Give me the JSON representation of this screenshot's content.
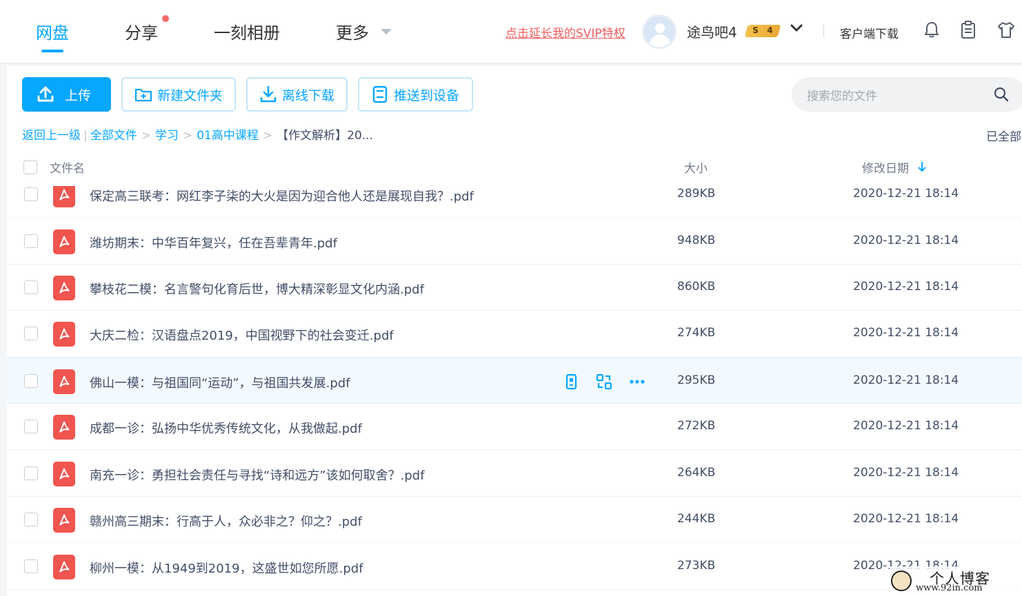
{
  "nav": {
    "tabs": [
      {
        "label": "网盘"
      },
      {
        "label": "分享"
      },
      {
        "label": "一刻相册"
      },
      {
        "label": "更多"
      }
    ],
    "svip_link": "点击延长我的SVIP特权",
    "username": "途鸟吧4",
    "vip_badge": {
      "s": "S",
      "level": "4"
    },
    "client_download": "客户端下载"
  },
  "toolbar": {
    "upload": "上传",
    "new_folder": "新建文件夹",
    "offline_download": "离线下载",
    "push_device": "推送到设备",
    "search_placeholder": "搜索您的文件"
  },
  "breadcrumb": {
    "back": "返回上一级",
    "all_files": "全部文件",
    "level1": "学习",
    "level2": "01高中课程",
    "current": "【作文解析】20...",
    "loaded_all": "已全部"
  },
  "table": {
    "col_name": "文件名",
    "col_size": "大小",
    "col_date": "修改日期",
    "rows": [
      {
        "name": "保定高三联考：网红李子柒的大火是因为迎合他人还是展现自我？.pdf",
        "size": "289KB",
        "date": "2020-12-21 18:14"
      },
      {
        "name": "潍坊期末：中华百年复兴，任在吾辈青年.pdf",
        "size": "948KB",
        "date": "2020-12-21 18:14"
      },
      {
        "name": "攀枝花二模：名言警句化育后世，博大精深彰显文化内涵.pdf",
        "size": "860KB",
        "date": "2020-12-21 18:14"
      },
      {
        "name": "大庆二检：汉语盘点2019，中国视野下的社会变迁.pdf",
        "size": "274KB",
        "date": "2020-12-21 18:14"
      },
      {
        "name": "佛山一模：与祖国同“运动”，与祖国共发展.pdf",
        "size": "295KB",
        "date": "2020-12-21 18:14"
      },
      {
        "name": "成都一诊：弘扬中华优秀传统文化，从我做起.pdf",
        "size": "272KB",
        "date": "2020-12-21 18:14"
      },
      {
        "name": "南充一诊：勇担社会责任与寻找“诗和远方”该如何取舍？.pdf",
        "size": "264KB",
        "date": "2020-12-21 18:14"
      },
      {
        "name": "赣州高三期末：行高于人，众必非之？仰之？.pdf",
        "size": "244KB",
        "date": "2020-12-21 18:14"
      },
      {
        "name": "柳州一模：从1949到2019，这盛世如您所愿.pdf",
        "size": "273KB",
        "date": "2020-12-21 18:14"
      }
    ]
  },
  "watermark": {
    "title": "个人博客",
    "url": "www.92in.com"
  },
  "colors": {
    "accent": "#06a7ff",
    "pdf": "#f0554f",
    "svip_link": "#f15d5d",
    "hover_row": "#f2faff"
  }
}
